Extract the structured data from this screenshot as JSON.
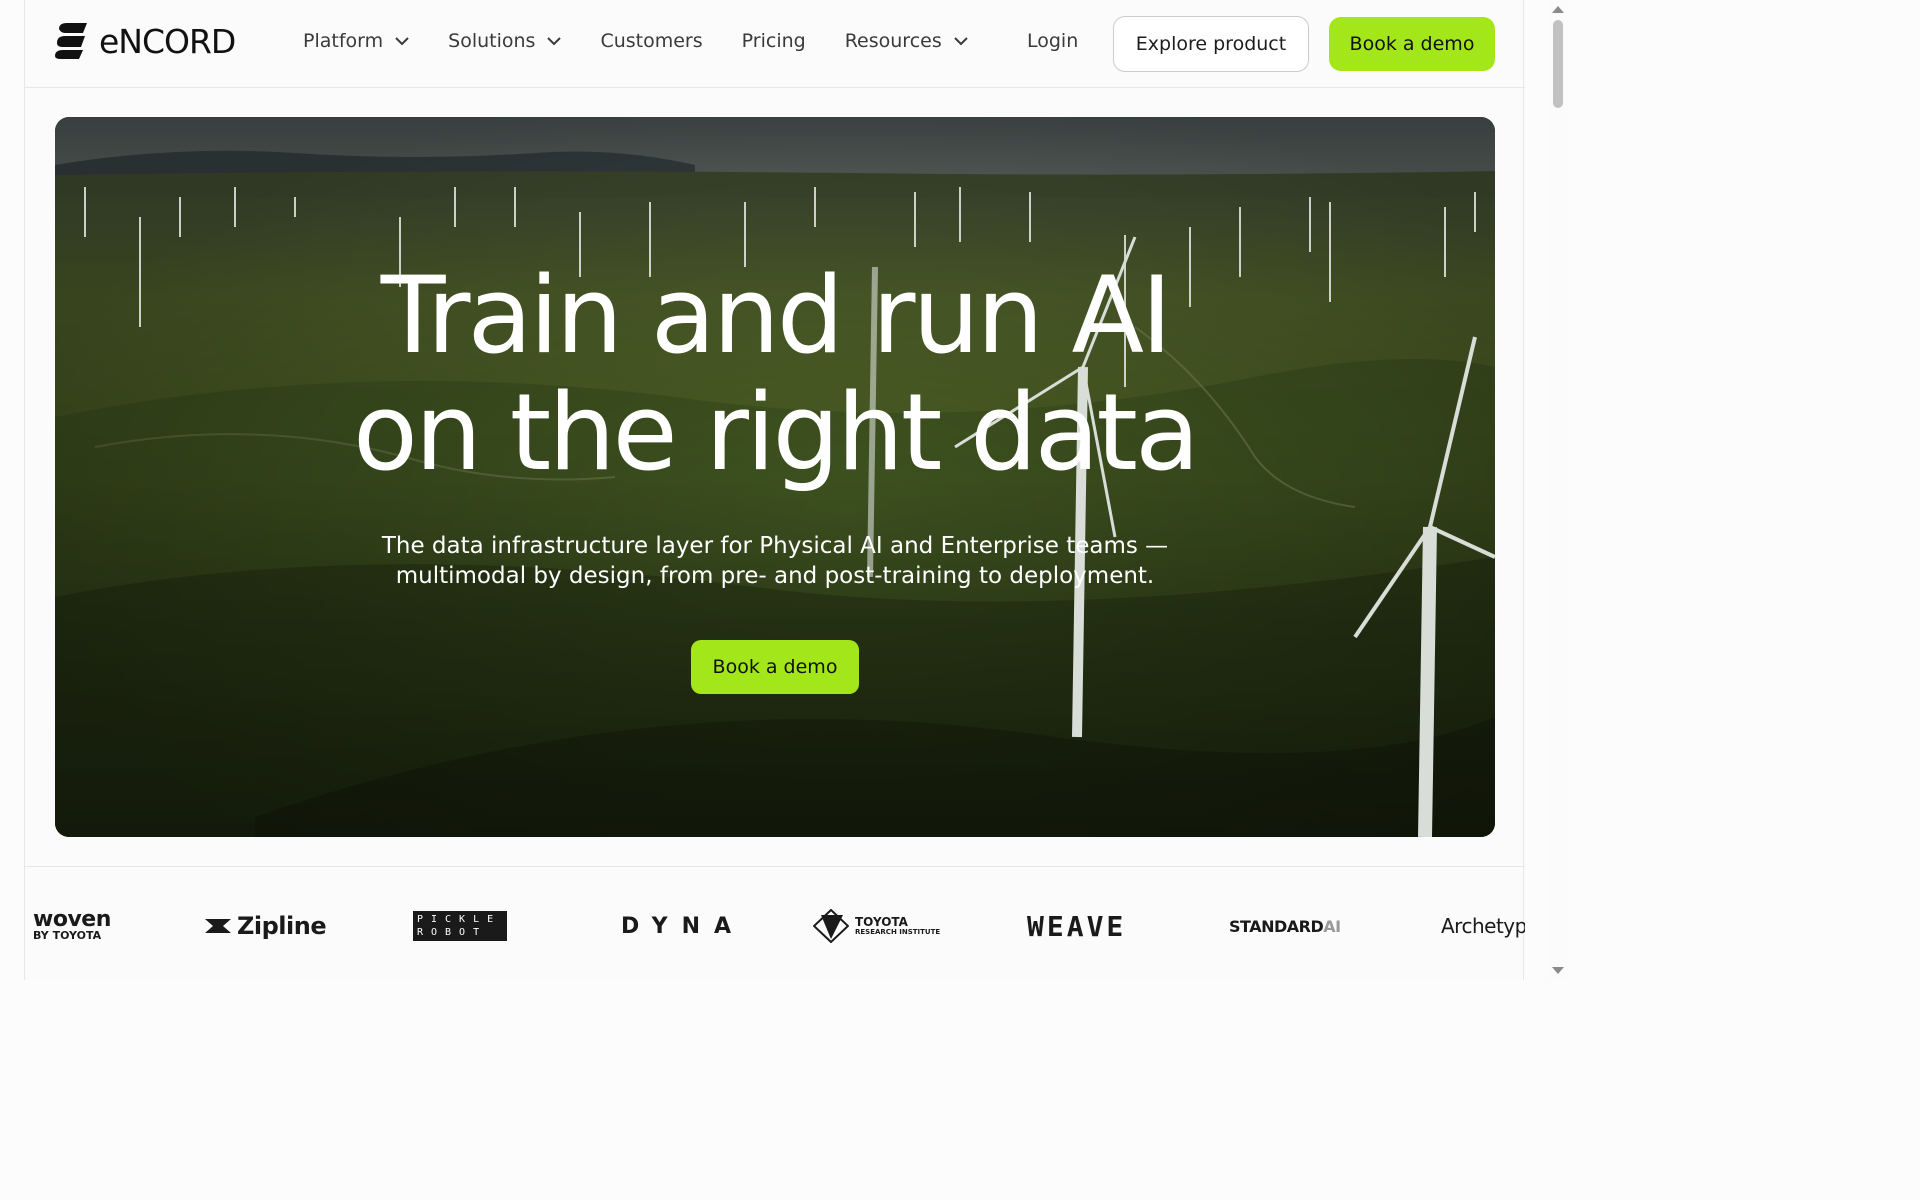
{
  "brand": {
    "logo_icon": "encord-logo-icon",
    "name": "eNCORD"
  },
  "nav": {
    "items": [
      {
        "label": "Platform",
        "has_dropdown": true
      },
      {
        "label": "Solutions",
        "has_dropdown": true
      },
      {
        "label": "Customers",
        "has_dropdown": false
      },
      {
        "label": "Pricing",
        "has_dropdown": false
      },
      {
        "label": "Resources",
        "has_dropdown": true
      }
    ],
    "login": "Login",
    "explore_button": "Explore product",
    "demo_button": "Book a demo"
  },
  "hero": {
    "title_line1": "Train and run AI",
    "title_line2": "on the right data",
    "subtitle_line1": "The data infrastructure layer for Physical AI and Enterprise teams —",
    "subtitle_line2": "multimodal by design, from pre- and post-training to deployment.",
    "cta": "Book a demo"
  },
  "customer_logos": {
    "woven": {
      "line1": "woven",
      "line2": "BY TOYOTA"
    },
    "zipline": "Zipline",
    "pickle": {
      "line1": "PICKLE",
      "line2": "ROBOT"
    },
    "dyna": "DYNA",
    "toyota_research": {
      "line1": "TOYOTA",
      "line2": "RESEARCH INSTITUTE"
    },
    "weave": "WEAVE",
    "standard": {
      "main": "STANDARD",
      "suffix": "AI"
    },
    "archetype": "Archetype"
  },
  "colors": {
    "accent": "#a3e61a",
    "text": "#1d1d1f",
    "border": "#e6e8e6"
  }
}
